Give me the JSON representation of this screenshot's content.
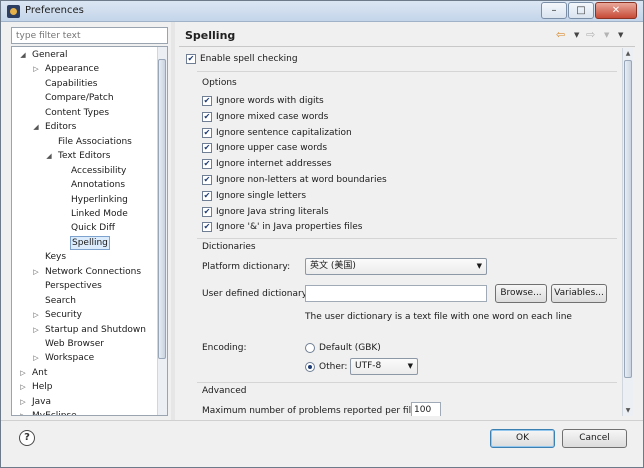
{
  "window": {
    "title": "Preferences"
  },
  "filter": {
    "placeholder": "type filter text"
  },
  "tree": {
    "items": [
      {
        "label": "General",
        "twisty": "open"
      },
      {
        "label": "Appearance",
        "twisty": "closed"
      },
      {
        "label": "Capabilities",
        "twisty": ""
      },
      {
        "label": "Compare/Patch",
        "twisty": ""
      },
      {
        "label": "Content Types",
        "twisty": ""
      },
      {
        "label": "Editors",
        "twisty": "open"
      },
      {
        "label": "File Associations",
        "twisty": ""
      },
      {
        "label": "Text Editors",
        "twisty": "open"
      },
      {
        "label": "Accessibility",
        "twisty": ""
      },
      {
        "label": "Annotations",
        "twisty": ""
      },
      {
        "label": "Hyperlinking",
        "twisty": ""
      },
      {
        "label": "Linked Mode",
        "twisty": ""
      },
      {
        "label": "Quick Diff",
        "twisty": ""
      },
      {
        "label": "Spelling",
        "twisty": "",
        "selected": true
      },
      {
        "label": "Keys",
        "twisty": ""
      },
      {
        "label": "Network Connections",
        "twisty": "closed"
      },
      {
        "label": "Perspectives",
        "twisty": ""
      },
      {
        "label": "Search",
        "twisty": ""
      },
      {
        "label": "Security",
        "twisty": "closed"
      },
      {
        "label": "Startup and Shutdown",
        "twisty": "closed"
      },
      {
        "label": "Web Browser",
        "twisty": ""
      },
      {
        "label": "Workspace",
        "twisty": "closed"
      },
      {
        "label": "Ant",
        "twisty": "closed"
      },
      {
        "label": "Help",
        "twisty": "closed"
      },
      {
        "label": "Java",
        "twisty": "closed"
      },
      {
        "label": "MyEclipse",
        "twisty": "closed"
      }
    ]
  },
  "page": {
    "title": "Spelling"
  },
  "enable": {
    "label": "Enable spell checking",
    "checked": true
  },
  "options": {
    "title": "Options",
    "items": [
      {
        "label": "Ignore words with digits",
        "checked": true
      },
      {
        "label": "Ignore mixed case words",
        "checked": true
      },
      {
        "label": "Ignore sentence capitalization",
        "checked": true
      },
      {
        "label": "Ignore upper case words",
        "checked": true
      },
      {
        "label": "Ignore internet addresses",
        "checked": true
      },
      {
        "label": "Ignore non-letters at word boundaries",
        "checked": true
      },
      {
        "label": "Ignore single letters",
        "checked": true
      },
      {
        "label": "Ignore Java string literals",
        "checked": true
      },
      {
        "label": "Ignore '&' in Java properties files",
        "checked": true
      }
    ]
  },
  "dictionaries": {
    "title": "Dictionaries",
    "platform_label": "Platform dictionary:",
    "platform_value": "英文 (美国)",
    "user_label": "User defined dictionary:",
    "user_value": "",
    "browse_label": "Browse...",
    "variables_label": "Variables...",
    "note": "The user dictionary is a text file with one word on each line",
    "encoding_label": "Encoding:",
    "default_label": "Default (GBK)",
    "other_label": "Other:",
    "other_value": "UTF-8",
    "selected_encoding": "other"
  },
  "advanced": {
    "title": "Advanced",
    "max_problems_label": "Maximum number of problems reported per file:",
    "max_problems_value": "100"
  },
  "buttons": {
    "ok": "OK",
    "cancel": "Cancel",
    "help": "?"
  }
}
